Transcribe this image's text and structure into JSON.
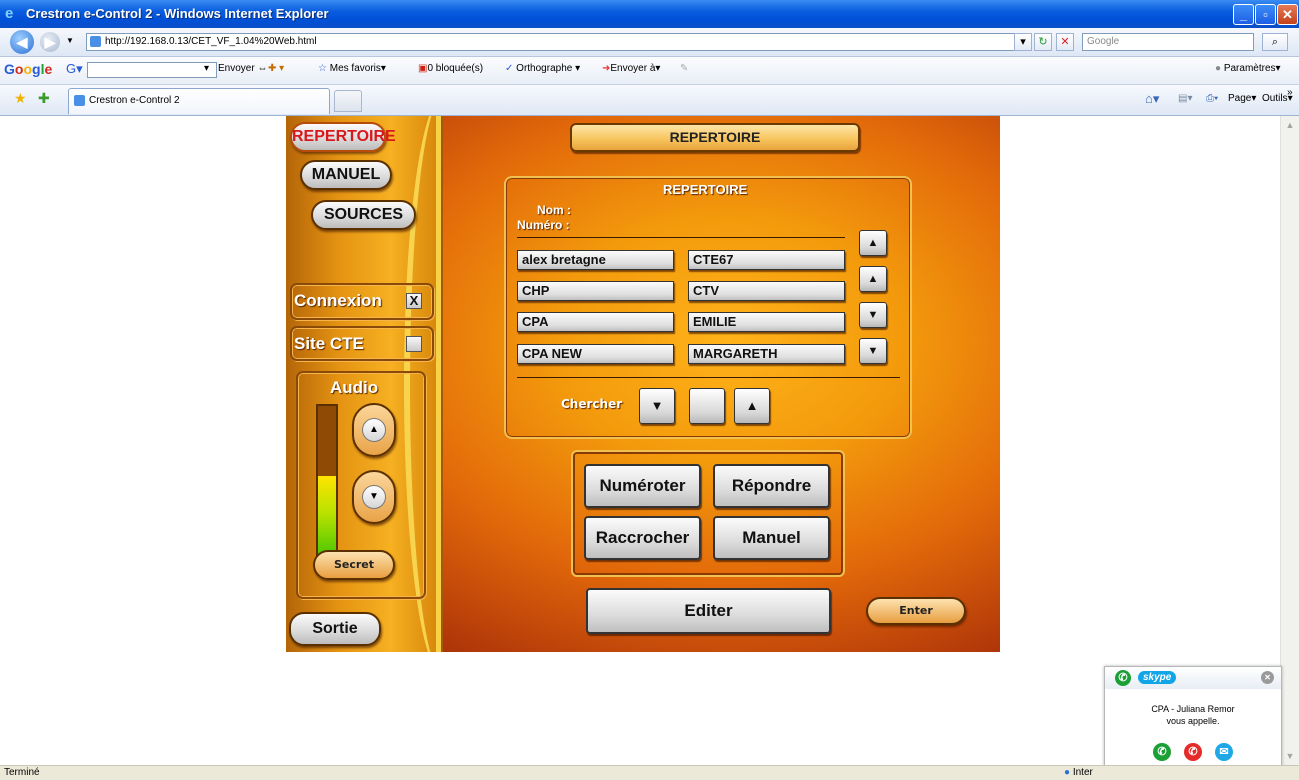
{
  "window": {
    "title": "Crestron e-Control 2 - Windows Internet Explorer"
  },
  "address": {
    "url": "http://192.168.0.13/CET_VF_1.04%20Web.html",
    "search_placeholder": "Google"
  },
  "googlebar": {
    "logo": "Google",
    "send_label": "Envoyer",
    "favorites_label": "Mes favoris",
    "blocked_label": "0 bloquée(s)",
    "spelling_label": "Orthographe",
    "send_to_label": "Envoyer à",
    "settings_label": "Paramètres"
  },
  "tabs": {
    "active_label": "Crestron e-Control 2",
    "page_label": "Page",
    "tools_label": "Outils"
  },
  "panel": {
    "nav": {
      "repertoire": "REPERTOIRE",
      "manuel": "MANUEL",
      "sources": "SOURCES"
    },
    "connexion_label": "Connexion",
    "connexion_mark": "X",
    "site_label": "Site CTE",
    "audio_label": "Audio",
    "audio_level_fraction": 0.55,
    "secret_label": "Secret",
    "sortie_label": "Sortie",
    "header_title": "REPERTOIRE",
    "directory": {
      "title": "REPERTOIRE",
      "nom_label": "Nom :",
      "numero_label": "Numéro :",
      "entries_left": [
        "alex bretagne",
        "CHP",
        "CPA",
        "CPA NEW"
      ],
      "entries_right": [
        "CTE67",
        "CTV",
        "EMILIE",
        "MARGARETH"
      ],
      "search_label": "Chercher"
    },
    "actions": {
      "dial": "Numéroter",
      "answer": "Répondre",
      "hangup": "Raccrocher",
      "manual": "Manuel"
    },
    "edit_label": "Editer",
    "enter_label": "Enter"
  },
  "skype": {
    "brand": "skype",
    "message_line1": "CPA - Juliana Remor",
    "message_line2": "vous appelle."
  },
  "status": {
    "left": "Terminé",
    "zone": "Inter"
  }
}
